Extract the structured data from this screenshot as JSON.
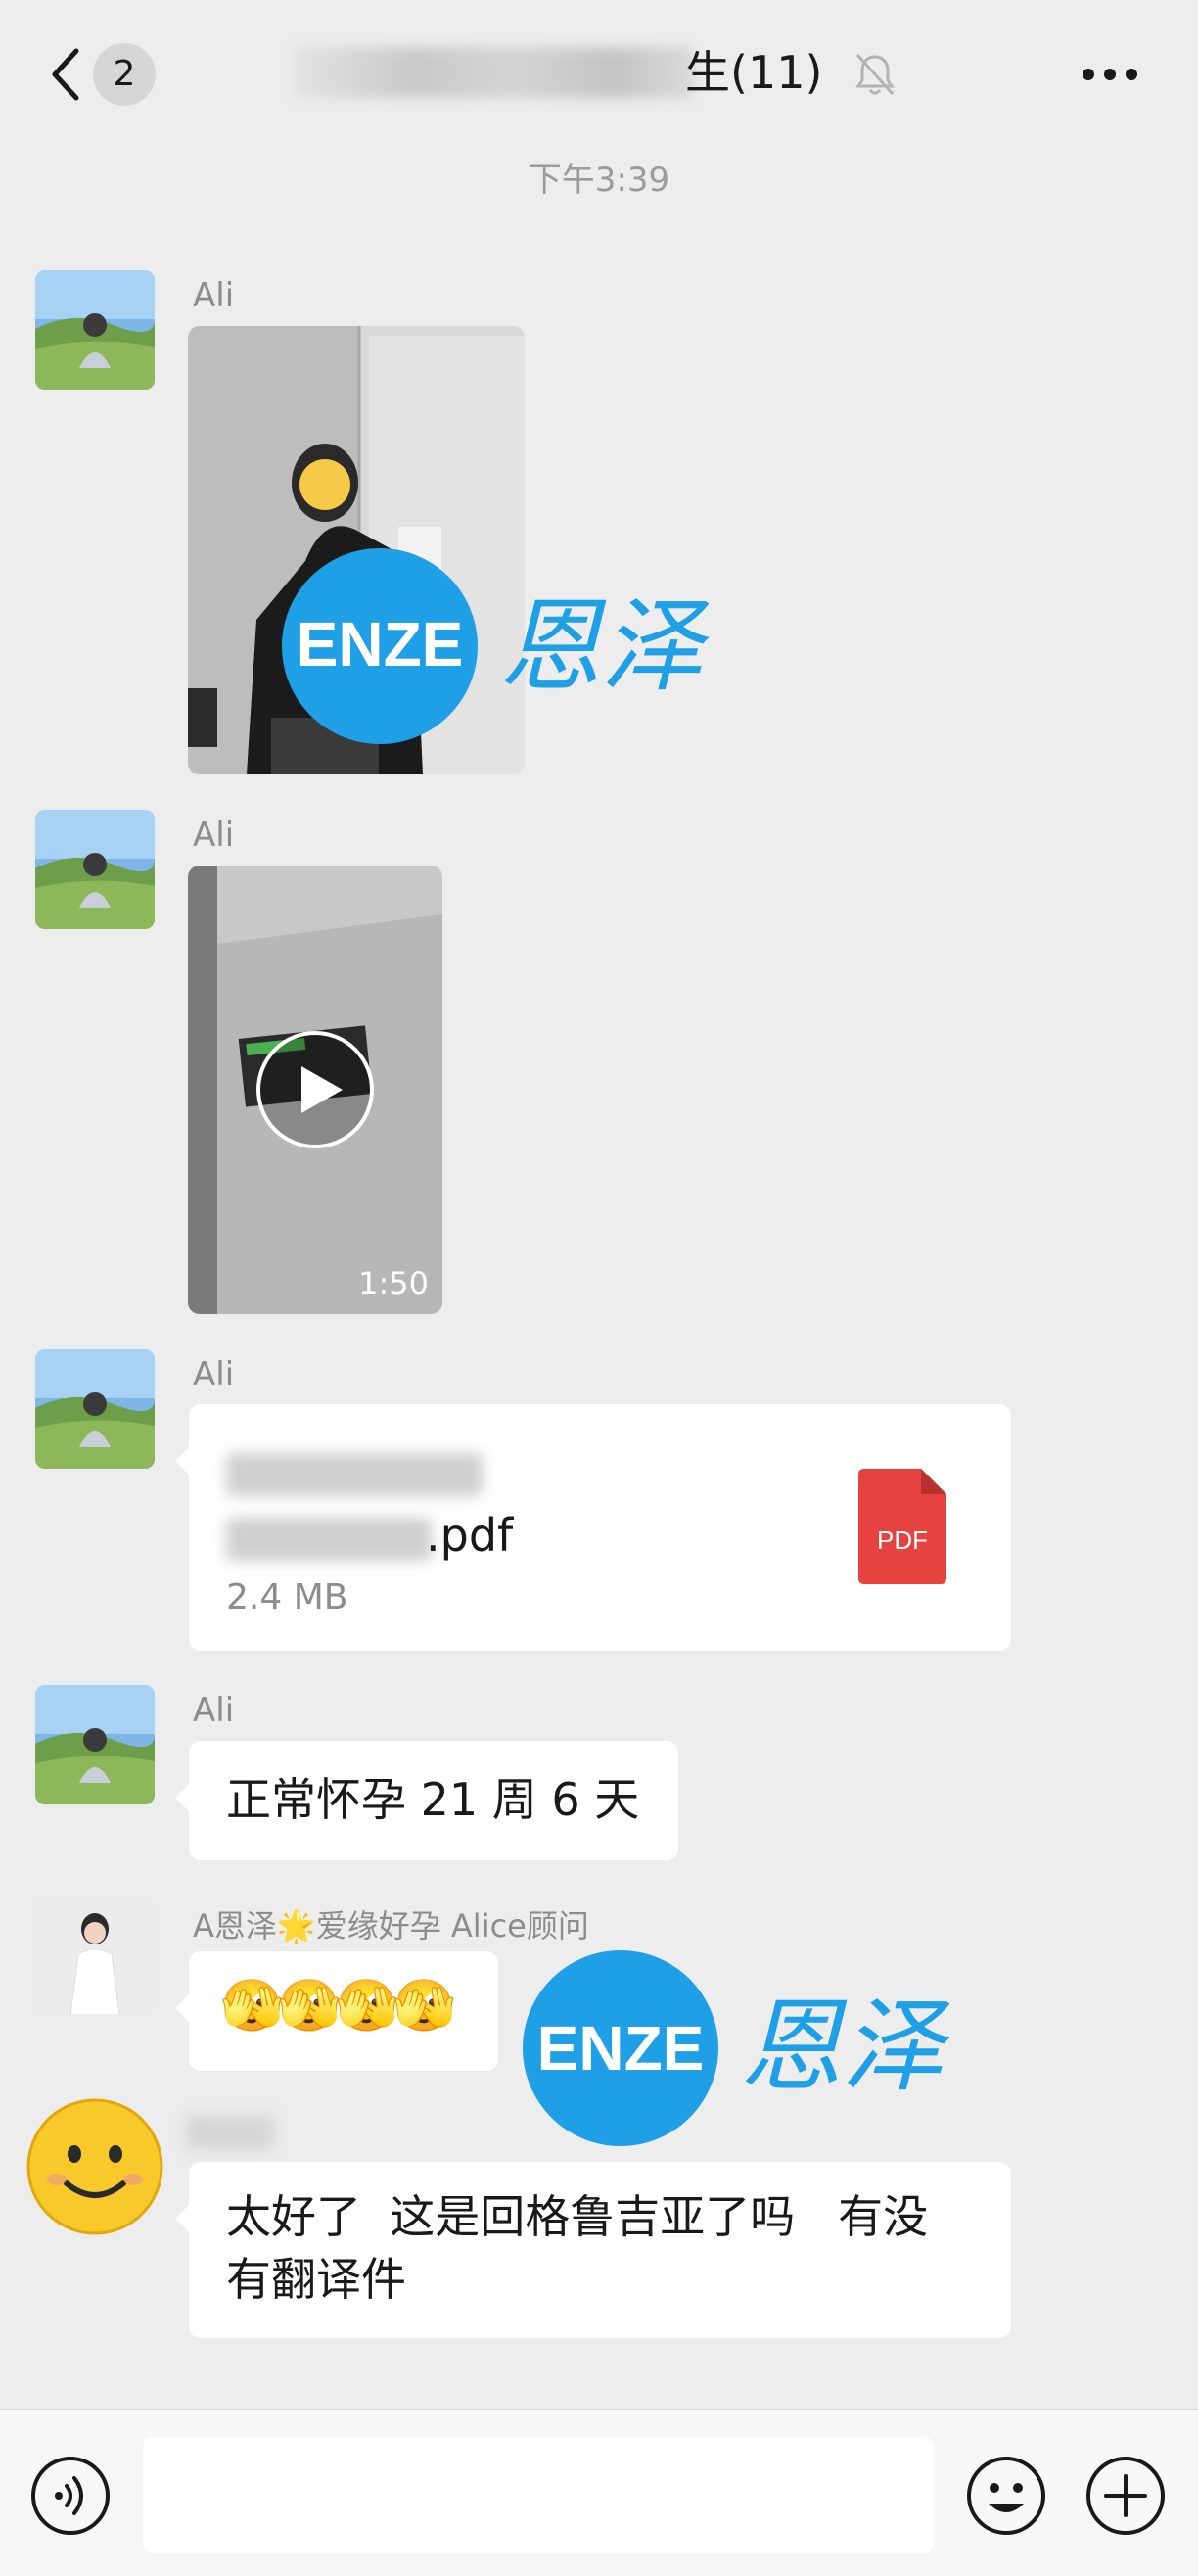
{
  "header": {
    "unread_count": "2",
    "title_suffix": "生(11)"
  },
  "timestamp": "下午3:39",
  "messages": [
    {
      "sender": "Ali",
      "type": "image"
    },
    {
      "sender": "Ali",
      "type": "video",
      "duration": "1:50"
    },
    {
      "sender": "Ali",
      "type": "file",
      "file_name_visible": ".pdf",
      "file_size": "2.4 MB",
      "file_badge": "PDF"
    },
    {
      "sender": "Ali",
      "type": "text",
      "text": "正常怀孕 21 周 6 天"
    },
    {
      "sender": "A恩泽🌟爱缘好孕 Alice顾问",
      "type": "emoji",
      "text": "🫣🫣🫣🫣"
    },
    {
      "sender": "",
      "type": "text",
      "text_line1": "太好了  这是回格鲁吉亚了吗   有没",
      "text_line2": "有翻译件"
    }
  ],
  "watermark": {
    "latin": "ENZE",
    "cjk": "恩泽"
  },
  "colors": {
    "background": "#ededed",
    "bubble": "#ffffff",
    "accent_watermark": "#1e9fe6",
    "pdf_red": "#e64340"
  },
  "icons": [
    "back-icon",
    "mute-bell-icon",
    "more-icon",
    "play-icon",
    "pdf-file-icon",
    "voice-icon",
    "emoji-icon",
    "plus-icon"
  ]
}
